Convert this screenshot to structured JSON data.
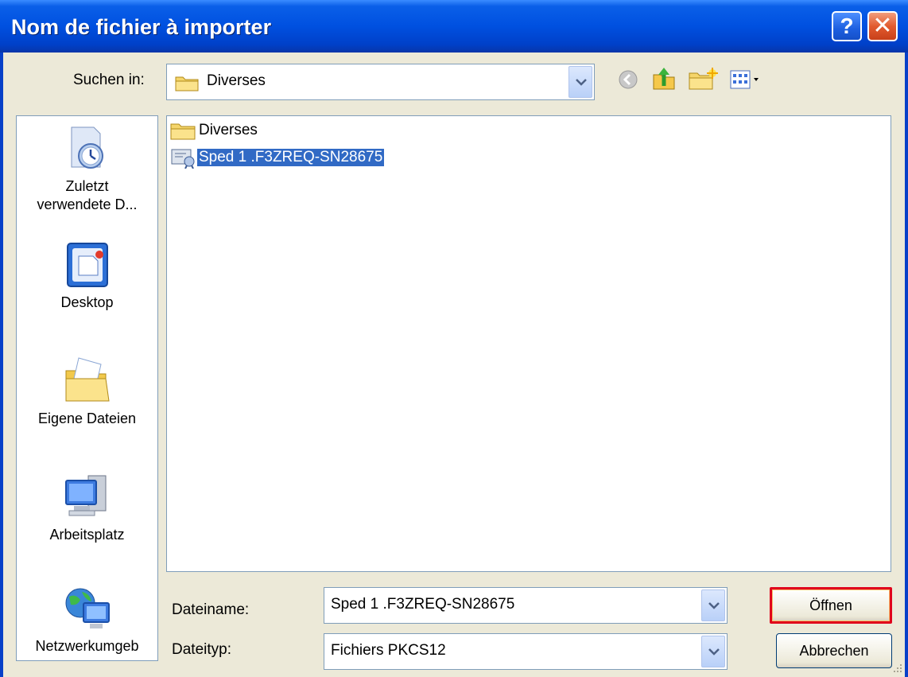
{
  "window": {
    "title": "Nom de fichier à importer"
  },
  "title_buttons": {
    "help": "?",
    "close": "✕"
  },
  "toolbar": {
    "look_in_label": "Suchen in:",
    "look_in_value": "Diverses",
    "icons": [
      "back-icon",
      "up-folder-icon",
      "new-folder-icon",
      "views-menu-icon"
    ]
  },
  "places": [
    {
      "label_line1": "Zuletzt",
      "label_line2": "verwendete D..."
    },
    {
      "label_line1": "Desktop",
      "label_line2": ""
    },
    {
      "label_line1": "Eigene Dateien",
      "label_line2": ""
    },
    {
      "label_line1": "Arbeitsplatz",
      "label_line2": ""
    },
    {
      "label_line1": "Netzwerkumgeb",
      "label_line2": ""
    }
  ],
  "files": [
    {
      "name": "Diverses",
      "type": "folder",
      "selected": false
    },
    {
      "name": "Sped 1 .F3ZREQ-SN28675",
      "type": "certificate",
      "selected": true
    }
  ],
  "form": {
    "filename_label": "Dateiname:",
    "filename_value": "Sped 1 .F3ZREQ-SN28675",
    "filetype_label": "Dateityp:",
    "filetype_value": "Fichiers PKCS12"
  },
  "buttons": {
    "open": "Öffnen",
    "cancel": "Abbrechen"
  },
  "colors": {
    "selection": "#316AC5",
    "highlight_border": "#e0001b",
    "titlebar": "#0050E0"
  }
}
